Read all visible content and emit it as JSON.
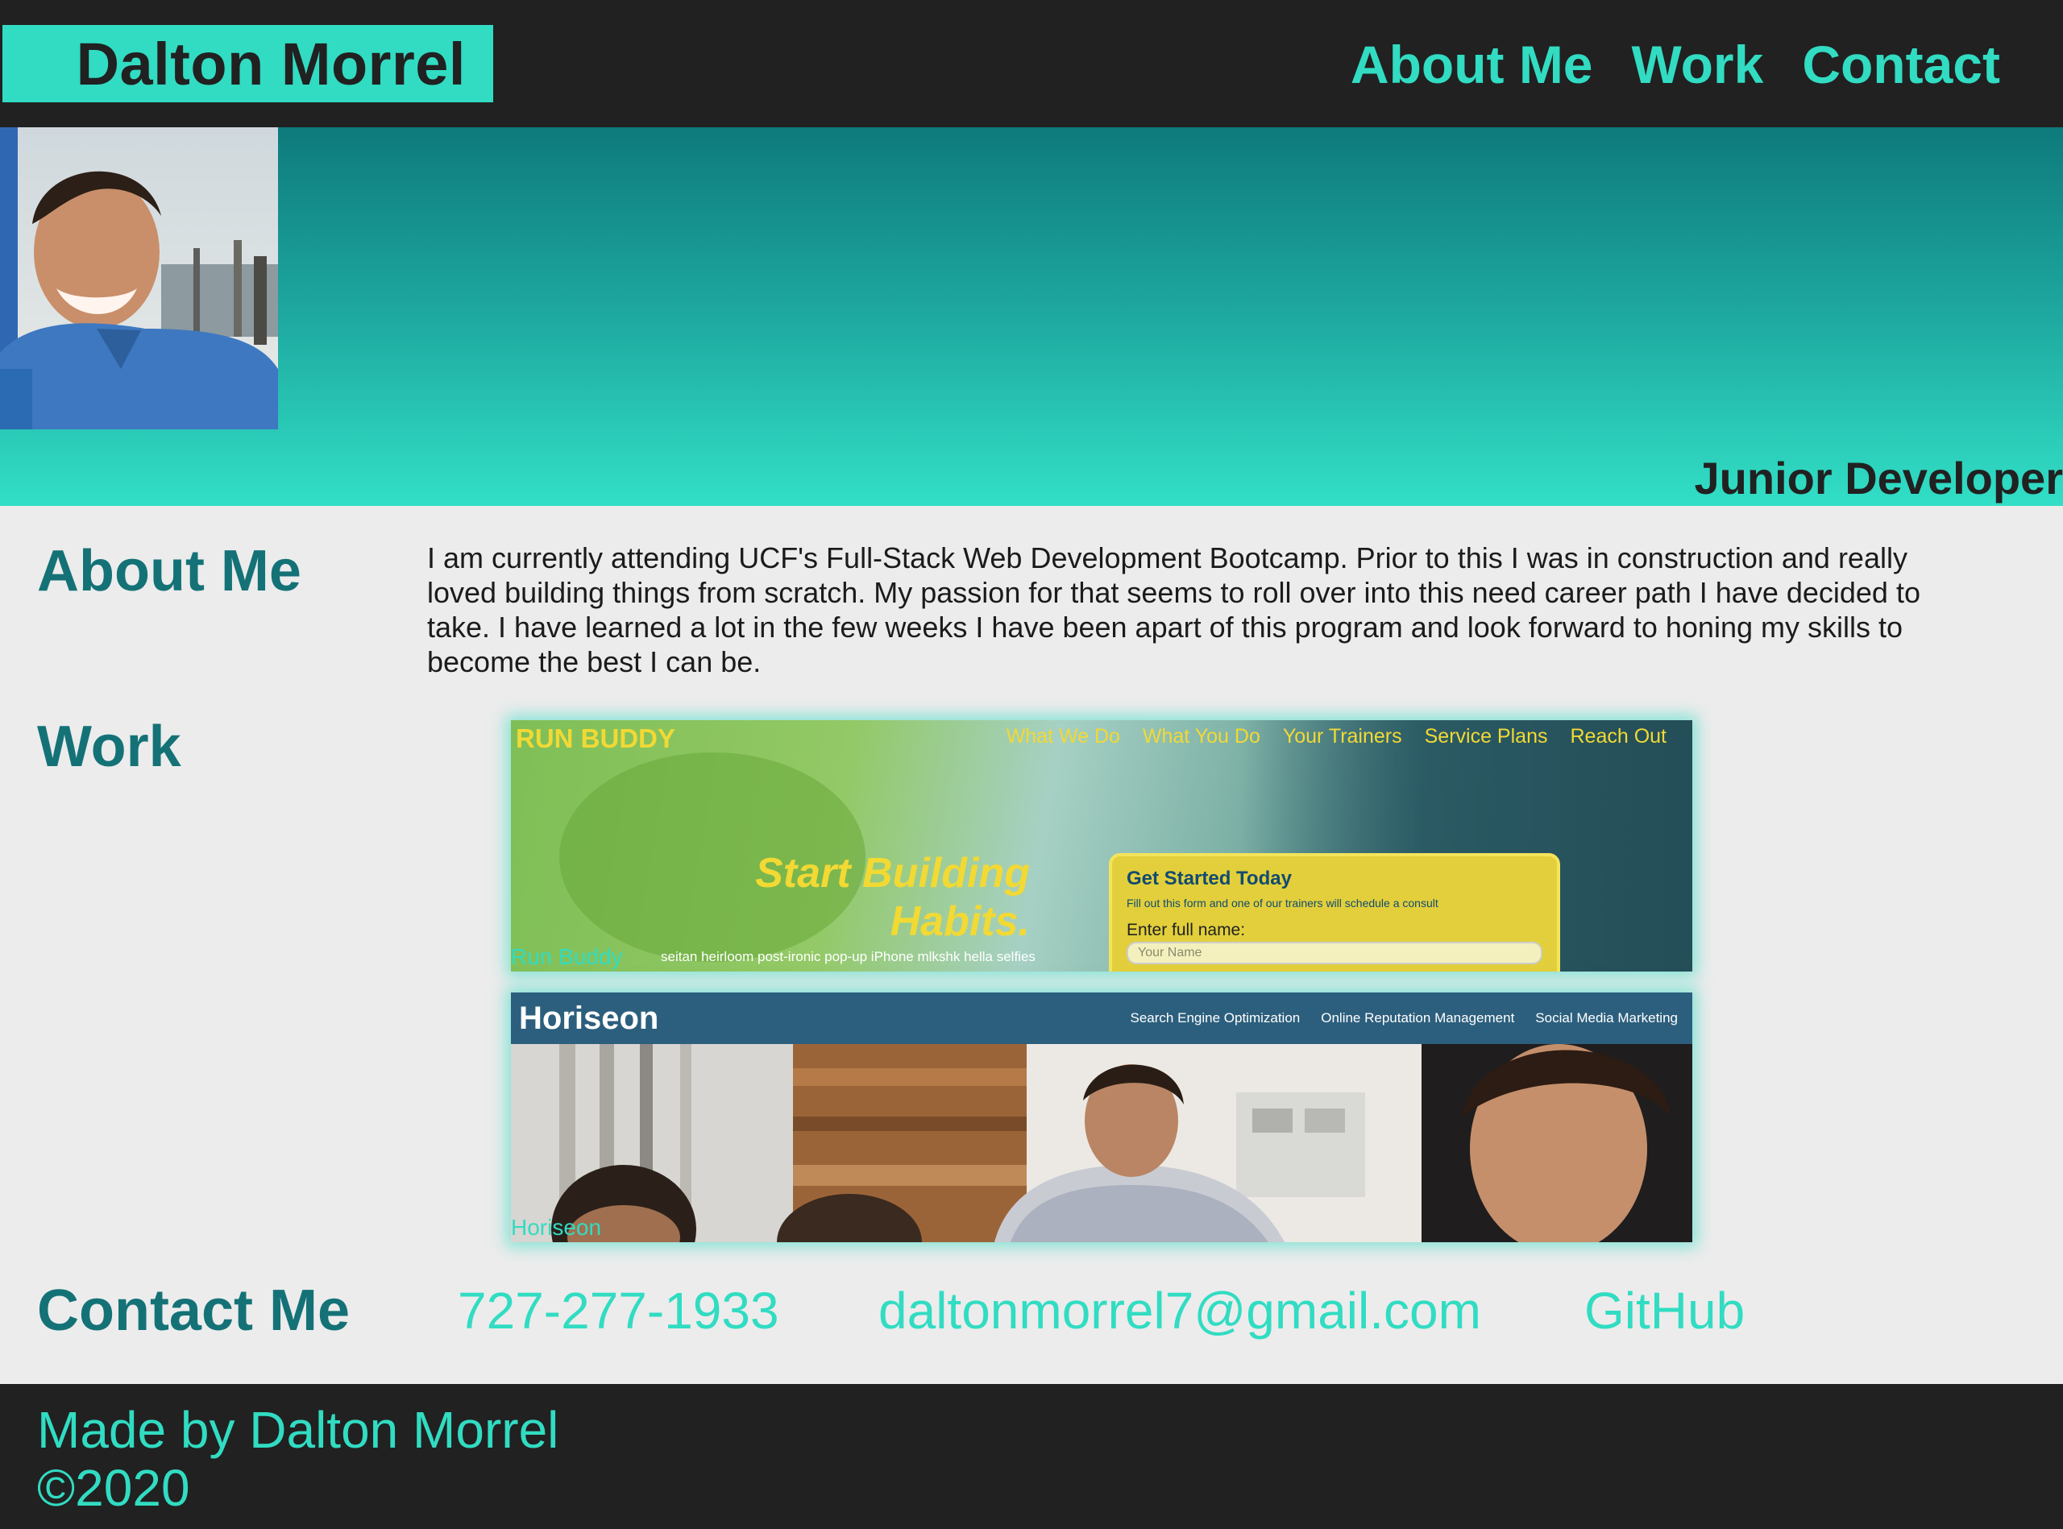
{
  "header": {
    "brand": "Dalton Morrel",
    "nav": [
      {
        "label": "About Me"
      },
      {
        "label": "Work"
      },
      {
        "label": "Contact"
      }
    ]
  },
  "hero": {
    "title": "Junior Developer"
  },
  "about": {
    "heading": "About Me",
    "text": "I am currently attending UCF's Full-Stack Web Development Bootcamp. Prior to this I was in construction and really loved building things from scratch. My passion for that seems to roll over into this need career path I have decided to take. I have learned a lot in the few weeks I have been apart of this program and look forward to honing my skills to become the best I can be."
  },
  "work": {
    "heading": "Work",
    "projects": [
      {
        "caption": "Run Buddy",
        "screenshot": {
          "logo": "RUN BUDDY",
          "nav": [
            "What We Do",
            "What You Do",
            "Your Trainers",
            "Service Plans",
            "Reach Out"
          ],
          "headline_line1": "Start Building",
          "headline_line2": "Habits.",
          "subtext": "seitan heirloom post-ironic pop-up iPhone mlkshk hella selfies",
          "form_title": "Get Started Today",
          "form_desc": "Fill out this form and one of our trainers will schedule a consult",
          "form_label": "Enter full name:",
          "form_placeholder": "Your Name"
        }
      },
      {
        "caption": "Horiseon",
        "screenshot": {
          "logo": "Horiseon",
          "nav": [
            "Search Engine Optimization",
            "Online Reputation Management",
            "Social Media Marketing"
          ]
        }
      }
    ]
  },
  "contact": {
    "heading": "Contact Me",
    "phone": "727-277-1933",
    "email": "daltonmorrel7@gmail.com",
    "github": "GitHub"
  },
  "footer": {
    "line1": "Made by Dalton Morrel",
    "line2": "©2020"
  },
  "colors": {
    "accent": "#31dcc2",
    "dark": "#212121",
    "heading": "#147277",
    "background": "#ececec"
  }
}
